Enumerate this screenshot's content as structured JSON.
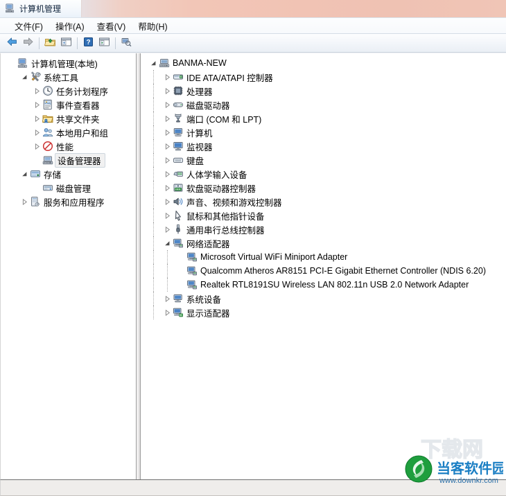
{
  "window": {
    "title": "计算机管理",
    "title_icon": "computer-management-icon"
  },
  "menubar": {
    "items": [
      {
        "label": "文件(F)",
        "name": "menu-file"
      },
      {
        "label": "操作(A)",
        "name": "menu-action"
      },
      {
        "label": "查看(V)",
        "name": "menu-view"
      },
      {
        "label": "帮助(H)",
        "name": "menu-help"
      }
    ]
  },
  "toolbar": {
    "buttons": [
      {
        "name": "back-button",
        "icon": "back-arrow-icon",
        "tooltip": "后退"
      },
      {
        "name": "forward-button",
        "icon": "forward-arrow-icon",
        "tooltip": "前进"
      },
      {
        "name": "up-one-level-button",
        "icon": "folder-up-icon",
        "tooltip": "上一级"
      },
      {
        "name": "show-hide-console-tree-button",
        "icon": "console-tree-icon",
        "tooltip": "显示/隐藏控制台树"
      },
      {
        "name": "help-button",
        "icon": "help-question-icon",
        "tooltip": "帮助"
      },
      {
        "name": "show-action-pane-button",
        "icon": "action-pane-icon",
        "tooltip": "显示/隐藏操作窗格"
      },
      {
        "name": "scan-hardware-changes-button",
        "icon": "scan-hardware-icon",
        "tooltip": "扫描检测硬件改动"
      }
    ]
  },
  "left_tree": {
    "nodes": [
      {
        "label": "计算机管理(本地)",
        "icon": "computer-management-icon",
        "indent": 0,
        "twist": "none",
        "selected": false
      },
      {
        "label": "系统工具",
        "icon": "system-tools-icon",
        "indent": 1,
        "twist": "expanded",
        "selected": false
      },
      {
        "label": "任务计划程序",
        "icon": "task-scheduler-clock-icon",
        "indent": 2,
        "twist": "collapsed",
        "selected": false
      },
      {
        "label": "事件查看器",
        "icon": "event-viewer-icon",
        "indent": 2,
        "twist": "collapsed",
        "selected": false
      },
      {
        "label": "共享文件夹",
        "icon": "shared-folders-icon",
        "indent": 2,
        "twist": "collapsed",
        "selected": false
      },
      {
        "label": "本地用户和组",
        "icon": "local-users-groups-icon",
        "indent": 2,
        "twist": "collapsed",
        "selected": false
      },
      {
        "label": "性能",
        "icon": "performance-icon",
        "indent": 2,
        "twist": "collapsed",
        "selected": false
      },
      {
        "label": "设备管理器",
        "icon": "device-manager-icon",
        "indent": 2,
        "twist": "none",
        "selected": true
      },
      {
        "label": "存储",
        "icon": "storage-icon",
        "indent": 1,
        "twist": "expanded",
        "selected": false
      },
      {
        "label": "磁盘管理",
        "icon": "disk-management-icon",
        "indent": 2,
        "twist": "none",
        "selected": false
      },
      {
        "label": "服务和应用程序",
        "icon": "services-applications-icon",
        "indent": 1,
        "twist": "collapsed",
        "selected": false
      }
    ]
  },
  "device_tree": {
    "nodes": [
      {
        "label": "BANMA-NEW",
        "icon": "computer-root-icon",
        "indent": 0,
        "twist": "expanded"
      },
      {
        "label": "IDE ATA/ATAPI 控制器",
        "icon": "ide-controller-icon",
        "indent": 1,
        "twist": "collapsed"
      },
      {
        "label": "处理器",
        "icon": "processor-icon",
        "indent": 1,
        "twist": "collapsed"
      },
      {
        "label": "磁盘驱动器",
        "icon": "disk-drive-icon",
        "indent": 1,
        "twist": "collapsed"
      },
      {
        "label": "端口 (COM 和 LPT)",
        "icon": "ports-icon",
        "indent": 1,
        "twist": "collapsed"
      },
      {
        "label": "计算机",
        "icon": "computer-icon",
        "indent": 1,
        "twist": "collapsed"
      },
      {
        "label": "监视器",
        "icon": "monitor-icon",
        "indent": 1,
        "twist": "collapsed"
      },
      {
        "label": "键盘",
        "icon": "keyboard-icon",
        "indent": 1,
        "twist": "collapsed"
      },
      {
        "label": "人体学输入设备",
        "icon": "hid-input-device-icon",
        "indent": 1,
        "twist": "collapsed"
      },
      {
        "label": "软盘驱动器控制器",
        "icon": "floppy-controller-icon",
        "indent": 1,
        "twist": "collapsed"
      },
      {
        "label": "声音、视频和游戏控制器",
        "icon": "sound-video-game-icon",
        "indent": 1,
        "twist": "collapsed"
      },
      {
        "label": "鼠标和其他指针设备",
        "icon": "mouse-icon",
        "indent": 1,
        "twist": "collapsed"
      },
      {
        "label": "通用串行总线控制器",
        "icon": "usb-controller-icon",
        "indent": 1,
        "twist": "collapsed"
      },
      {
        "label": "网络适配器",
        "icon": "network-adapter-icon",
        "indent": 1,
        "twist": "expanded"
      },
      {
        "label": "Microsoft Virtual WiFi Miniport Adapter",
        "icon": "network-adapter-icon",
        "indent": 2,
        "twist": "none"
      },
      {
        "label": "Qualcomm Atheros AR8151 PCI-E Gigabit Ethernet Controller (NDIS 6.20)",
        "icon": "network-adapter-icon",
        "indent": 2,
        "twist": "none"
      },
      {
        "label": "Realtek RTL8191SU Wireless LAN 802.11n USB 2.0 Network Adapter",
        "icon": "network-adapter-icon",
        "indent": 2,
        "twist": "none"
      },
      {
        "label": "系统设备",
        "icon": "system-device-icon",
        "indent": 1,
        "twist": "collapsed"
      },
      {
        "label": "显示适配器",
        "icon": "display-adapter-icon",
        "indent": 1,
        "twist": "collapsed"
      }
    ]
  },
  "statusbar": {
    "text": ""
  },
  "watermark": {
    "big_text": "下载网",
    "brand": "当客软件园",
    "url": "www.downkr.com"
  },
  "colors": {
    "title_left": "#eaf2fa",
    "title_right": "#f1c3b4",
    "selection_border": "#cdd6dd",
    "tree_line": "#a8a8a8",
    "accent_blue": "#3a7bbf"
  }
}
